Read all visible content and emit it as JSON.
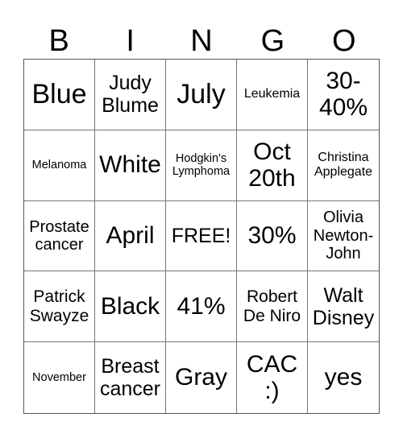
{
  "header": [
    "B",
    "I",
    "N",
    "G",
    "O"
  ],
  "cells": [
    "Blue",
    "Judy Blume",
    "July",
    "Leukemia",
    "30-40%",
    "Melanoma",
    "White",
    "Hodgkin's Lymphoma",
    "Oct 20th",
    "Christina Applegate",
    "Prostate cancer",
    "April",
    "FREE!",
    "30%",
    "Olivia Newton-John",
    "Patrick Swayze",
    "Black",
    "41%",
    "Robert De Niro",
    "Walt Disney",
    "November",
    "Breast cancer",
    "Gray",
    "CAC :)",
    "yes"
  ]
}
